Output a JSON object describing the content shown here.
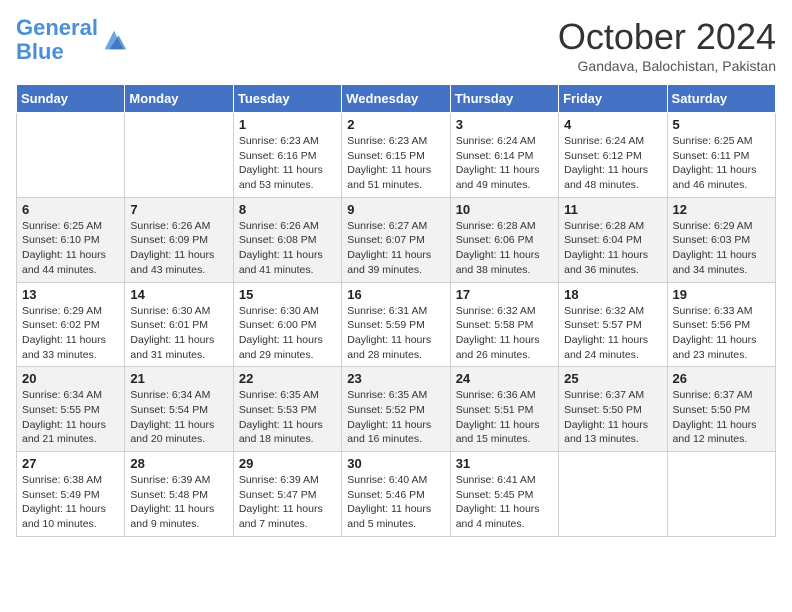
{
  "header": {
    "logo_line1": "General",
    "logo_line2": "Blue",
    "month": "October 2024",
    "location": "Gandava, Balochistan, Pakistan"
  },
  "days_of_week": [
    "Sunday",
    "Monday",
    "Tuesday",
    "Wednesday",
    "Thursday",
    "Friday",
    "Saturday"
  ],
  "weeks": [
    [
      {
        "day": "",
        "info": ""
      },
      {
        "day": "",
        "info": ""
      },
      {
        "day": "1",
        "info": "Sunrise: 6:23 AM\nSunset: 6:16 PM\nDaylight: 11 hours and 53 minutes."
      },
      {
        "day": "2",
        "info": "Sunrise: 6:23 AM\nSunset: 6:15 PM\nDaylight: 11 hours and 51 minutes."
      },
      {
        "day": "3",
        "info": "Sunrise: 6:24 AM\nSunset: 6:14 PM\nDaylight: 11 hours and 49 minutes."
      },
      {
        "day": "4",
        "info": "Sunrise: 6:24 AM\nSunset: 6:12 PM\nDaylight: 11 hours and 48 minutes."
      },
      {
        "day": "5",
        "info": "Sunrise: 6:25 AM\nSunset: 6:11 PM\nDaylight: 11 hours and 46 minutes."
      }
    ],
    [
      {
        "day": "6",
        "info": "Sunrise: 6:25 AM\nSunset: 6:10 PM\nDaylight: 11 hours and 44 minutes."
      },
      {
        "day": "7",
        "info": "Sunrise: 6:26 AM\nSunset: 6:09 PM\nDaylight: 11 hours and 43 minutes."
      },
      {
        "day": "8",
        "info": "Sunrise: 6:26 AM\nSunset: 6:08 PM\nDaylight: 11 hours and 41 minutes."
      },
      {
        "day": "9",
        "info": "Sunrise: 6:27 AM\nSunset: 6:07 PM\nDaylight: 11 hours and 39 minutes."
      },
      {
        "day": "10",
        "info": "Sunrise: 6:28 AM\nSunset: 6:06 PM\nDaylight: 11 hours and 38 minutes."
      },
      {
        "day": "11",
        "info": "Sunrise: 6:28 AM\nSunset: 6:04 PM\nDaylight: 11 hours and 36 minutes."
      },
      {
        "day": "12",
        "info": "Sunrise: 6:29 AM\nSunset: 6:03 PM\nDaylight: 11 hours and 34 minutes."
      }
    ],
    [
      {
        "day": "13",
        "info": "Sunrise: 6:29 AM\nSunset: 6:02 PM\nDaylight: 11 hours and 33 minutes."
      },
      {
        "day": "14",
        "info": "Sunrise: 6:30 AM\nSunset: 6:01 PM\nDaylight: 11 hours and 31 minutes."
      },
      {
        "day": "15",
        "info": "Sunrise: 6:30 AM\nSunset: 6:00 PM\nDaylight: 11 hours and 29 minutes."
      },
      {
        "day": "16",
        "info": "Sunrise: 6:31 AM\nSunset: 5:59 PM\nDaylight: 11 hours and 28 minutes."
      },
      {
        "day": "17",
        "info": "Sunrise: 6:32 AM\nSunset: 5:58 PM\nDaylight: 11 hours and 26 minutes."
      },
      {
        "day": "18",
        "info": "Sunrise: 6:32 AM\nSunset: 5:57 PM\nDaylight: 11 hours and 24 minutes."
      },
      {
        "day": "19",
        "info": "Sunrise: 6:33 AM\nSunset: 5:56 PM\nDaylight: 11 hours and 23 minutes."
      }
    ],
    [
      {
        "day": "20",
        "info": "Sunrise: 6:34 AM\nSunset: 5:55 PM\nDaylight: 11 hours and 21 minutes."
      },
      {
        "day": "21",
        "info": "Sunrise: 6:34 AM\nSunset: 5:54 PM\nDaylight: 11 hours and 20 minutes."
      },
      {
        "day": "22",
        "info": "Sunrise: 6:35 AM\nSunset: 5:53 PM\nDaylight: 11 hours and 18 minutes."
      },
      {
        "day": "23",
        "info": "Sunrise: 6:35 AM\nSunset: 5:52 PM\nDaylight: 11 hours and 16 minutes."
      },
      {
        "day": "24",
        "info": "Sunrise: 6:36 AM\nSunset: 5:51 PM\nDaylight: 11 hours and 15 minutes."
      },
      {
        "day": "25",
        "info": "Sunrise: 6:37 AM\nSunset: 5:50 PM\nDaylight: 11 hours and 13 minutes."
      },
      {
        "day": "26",
        "info": "Sunrise: 6:37 AM\nSunset: 5:50 PM\nDaylight: 11 hours and 12 minutes."
      }
    ],
    [
      {
        "day": "27",
        "info": "Sunrise: 6:38 AM\nSunset: 5:49 PM\nDaylight: 11 hours and 10 minutes."
      },
      {
        "day": "28",
        "info": "Sunrise: 6:39 AM\nSunset: 5:48 PM\nDaylight: 11 hours and 9 minutes."
      },
      {
        "day": "29",
        "info": "Sunrise: 6:39 AM\nSunset: 5:47 PM\nDaylight: 11 hours and 7 minutes."
      },
      {
        "day": "30",
        "info": "Sunrise: 6:40 AM\nSunset: 5:46 PM\nDaylight: 11 hours and 5 minutes."
      },
      {
        "day": "31",
        "info": "Sunrise: 6:41 AM\nSunset: 5:45 PM\nDaylight: 11 hours and 4 minutes."
      },
      {
        "day": "",
        "info": ""
      },
      {
        "day": "",
        "info": ""
      }
    ]
  ]
}
